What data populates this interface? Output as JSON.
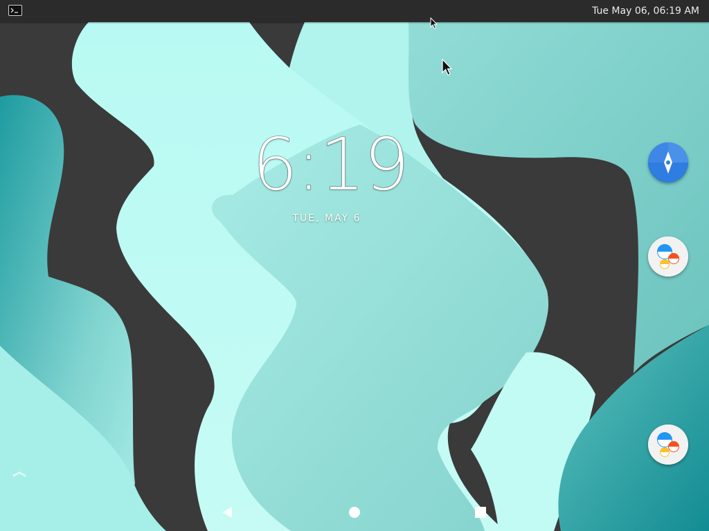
{
  "status_bar": {
    "datetime": "Tue May 06, 06:19 AM",
    "terminal_icon": "terminal-icon"
  },
  "lock_clock": {
    "time": "6:19",
    "date": "TUE, MAY 6"
  },
  "dock": {
    "items": [
      {
        "icon": "compass-app-icon"
      },
      {
        "icon": "messaging-app-icon"
      },
      {
        "icon": "messaging-app-icon"
      }
    ]
  },
  "navigation": {
    "back_icon": "back-triangle-icon",
    "home_icon": "home-circle-icon",
    "recents_icon": "recents-square-icon",
    "drawer_icon": "chevron-up-icon"
  },
  "colors": {
    "topbar": "#2b2b2b",
    "wallpaper_dark": "#3a3a3a",
    "wallpaper_light_cyan": "#b6f7f0",
    "wallpaper_mid_teal": "#8fd9d3",
    "wallpaper_deep_teal": "#1f9aa0",
    "compass_blue": "#2f7de1"
  }
}
